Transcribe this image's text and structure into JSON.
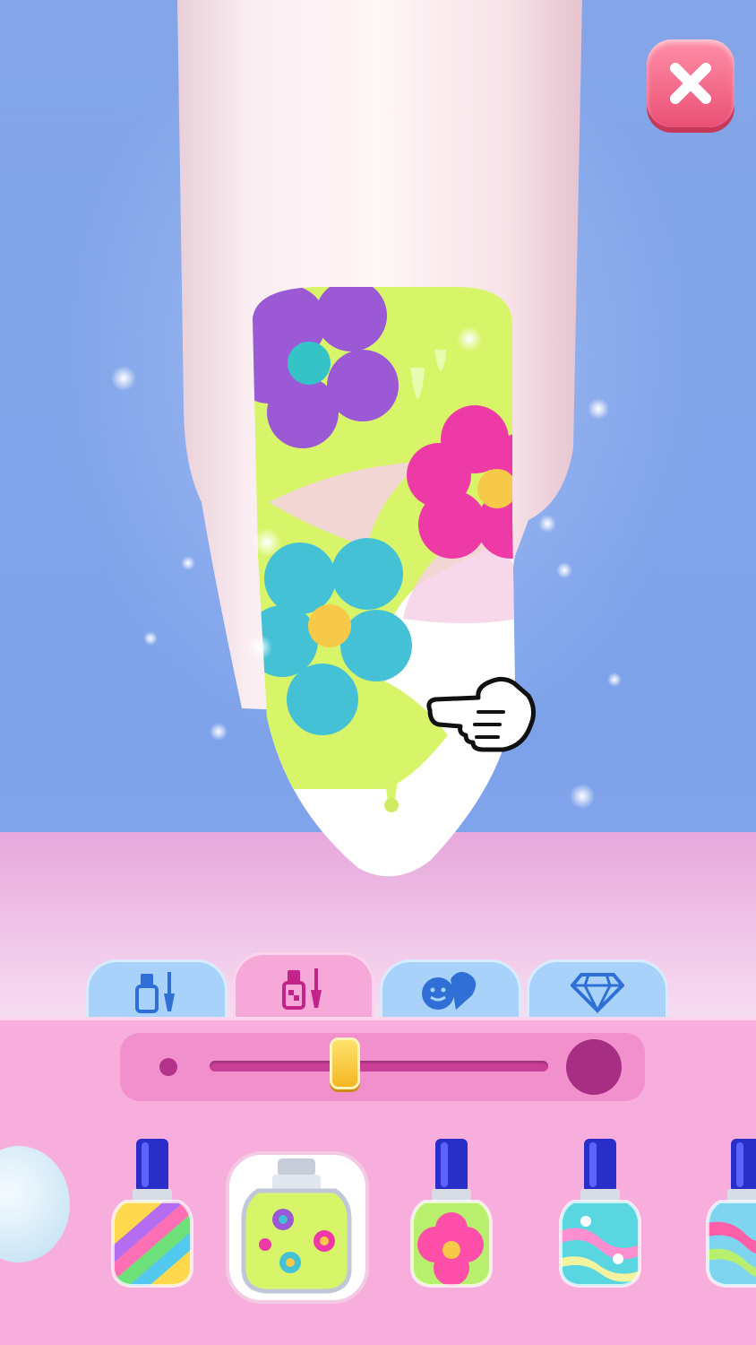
{
  "screen": "nail-polish-studio",
  "close_button": {
    "icon": "close-icon",
    "color": "#ef5a7e"
  },
  "nail": {
    "base_color": "#ffffff",
    "pattern_color": "#d8f56a",
    "flower_colors": [
      "#9b59d6",
      "#ee3aa6",
      "#45c1d6"
    ],
    "flower_center_color": "#f7c948"
  },
  "hint": {
    "icon": "pointing-hand-icon"
  },
  "tabs": [
    {
      "id": "polish",
      "icon": "polish-brush-icon",
      "active": false
    },
    {
      "id": "patterned-polish",
      "icon": "patterned-polish-icon",
      "active": true
    },
    {
      "id": "stickers",
      "icon": "sticker-heart-icon",
      "active": false
    },
    {
      "id": "gems",
      "icon": "diamond-icon",
      "active": false
    }
  ],
  "brush_size": {
    "value": 0.4,
    "min_icon": "small-dot-icon",
    "max_icon": "big-dot-icon"
  },
  "tools": [
    {
      "id": "cotton-pad",
      "icon": "cotton-pad-icon",
      "selected": false
    },
    {
      "id": "rainbow-stripes",
      "icon": "polish-bottle-icon",
      "colors": [
        "#ff6fb5",
        "#ffd84d",
        "#6ee07a",
        "#53c9f0",
        "#b46cf0"
      ],
      "selected": false
    },
    {
      "id": "green-flowers",
      "icon": "polish-jar-icon",
      "colors": [
        "#d8f56a",
        "#ee3aa6",
        "#45c1d6",
        "#9b59d6"
      ],
      "selected": true
    },
    {
      "id": "pink-flower",
      "icon": "polish-bottle-icon",
      "colors": [
        "#b8f06e",
        "#ff4fa8",
        "#f7c948"
      ],
      "selected": false
    },
    {
      "id": "aqua-swirl",
      "icon": "polish-bottle-icon",
      "colors": [
        "#59d6e0",
        "#ff8fd0",
        "#f4f4a0"
      ],
      "selected": false
    },
    {
      "id": "wave-swirl",
      "icon": "polish-bottle-icon",
      "colors": [
        "#7fd4f0",
        "#ff5fa8",
        "#b8f06e"
      ],
      "selected": false
    }
  ]
}
